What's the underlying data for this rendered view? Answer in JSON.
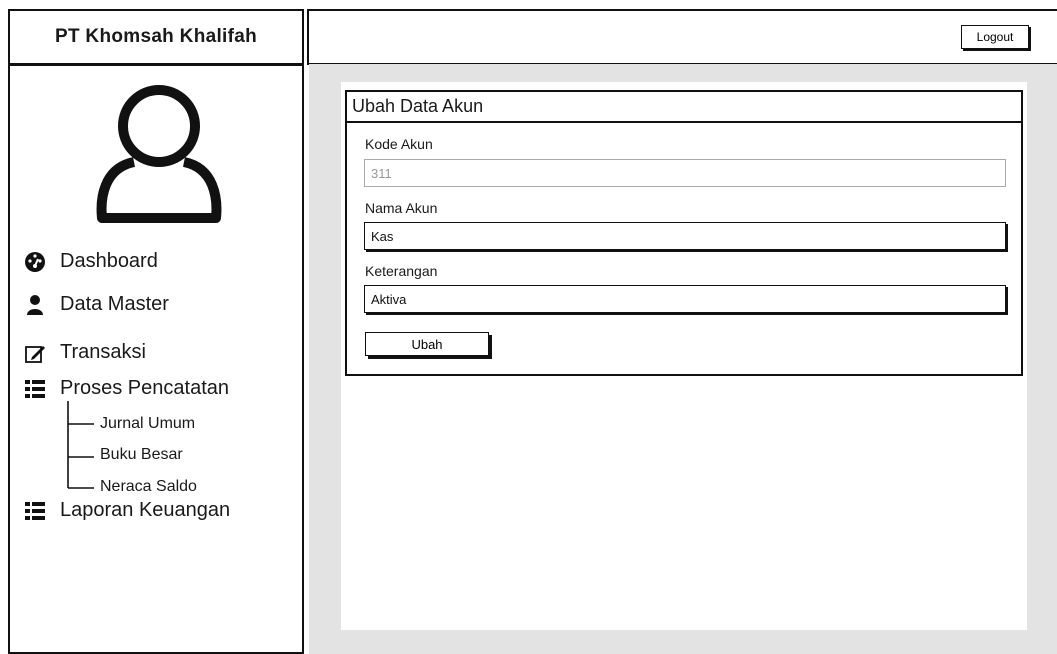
{
  "brand": {
    "title": "PT Khomsah Khalifah"
  },
  "topbar": {
    "logout_label": "Logout"
  },
  "sidebar": {
    "items": [
      {
        "label": "Dashboard",
        "icon": "dashboard-gauge-icon"
      },
      {
        "label": "Data Master",
        "icon": "user-icon"
      },
      {
        "label": "Transaksi",
        "icon": "edit-icon"
      },
      {
        "label": "Proses Pencatatan",
        "icon": "list-icon"
      },
      {
        "label": "Laporan Keuangan",
        "icon": "list-icon"
      }
    ],
    "subitems": [
      {
        "label": "Jurnal Umum"
      },
      {
        "label": "Buku Besar"
      },
      {
        "label": "Neraca Saldo"
      }
    ]
  },
  "form": {
    "title": "Ubah Data Akun",
    "fields": [
      {
        "label": "Kode Akun",
        "value": "311"
      },
      {
        "label": "Nama Akun",
        "value": "Kas"
      },
      {
        "label": "Keterangan",
        "value": "Aktiva"
      }
    ],
    "submit_label": "Ubah"
  }
}
